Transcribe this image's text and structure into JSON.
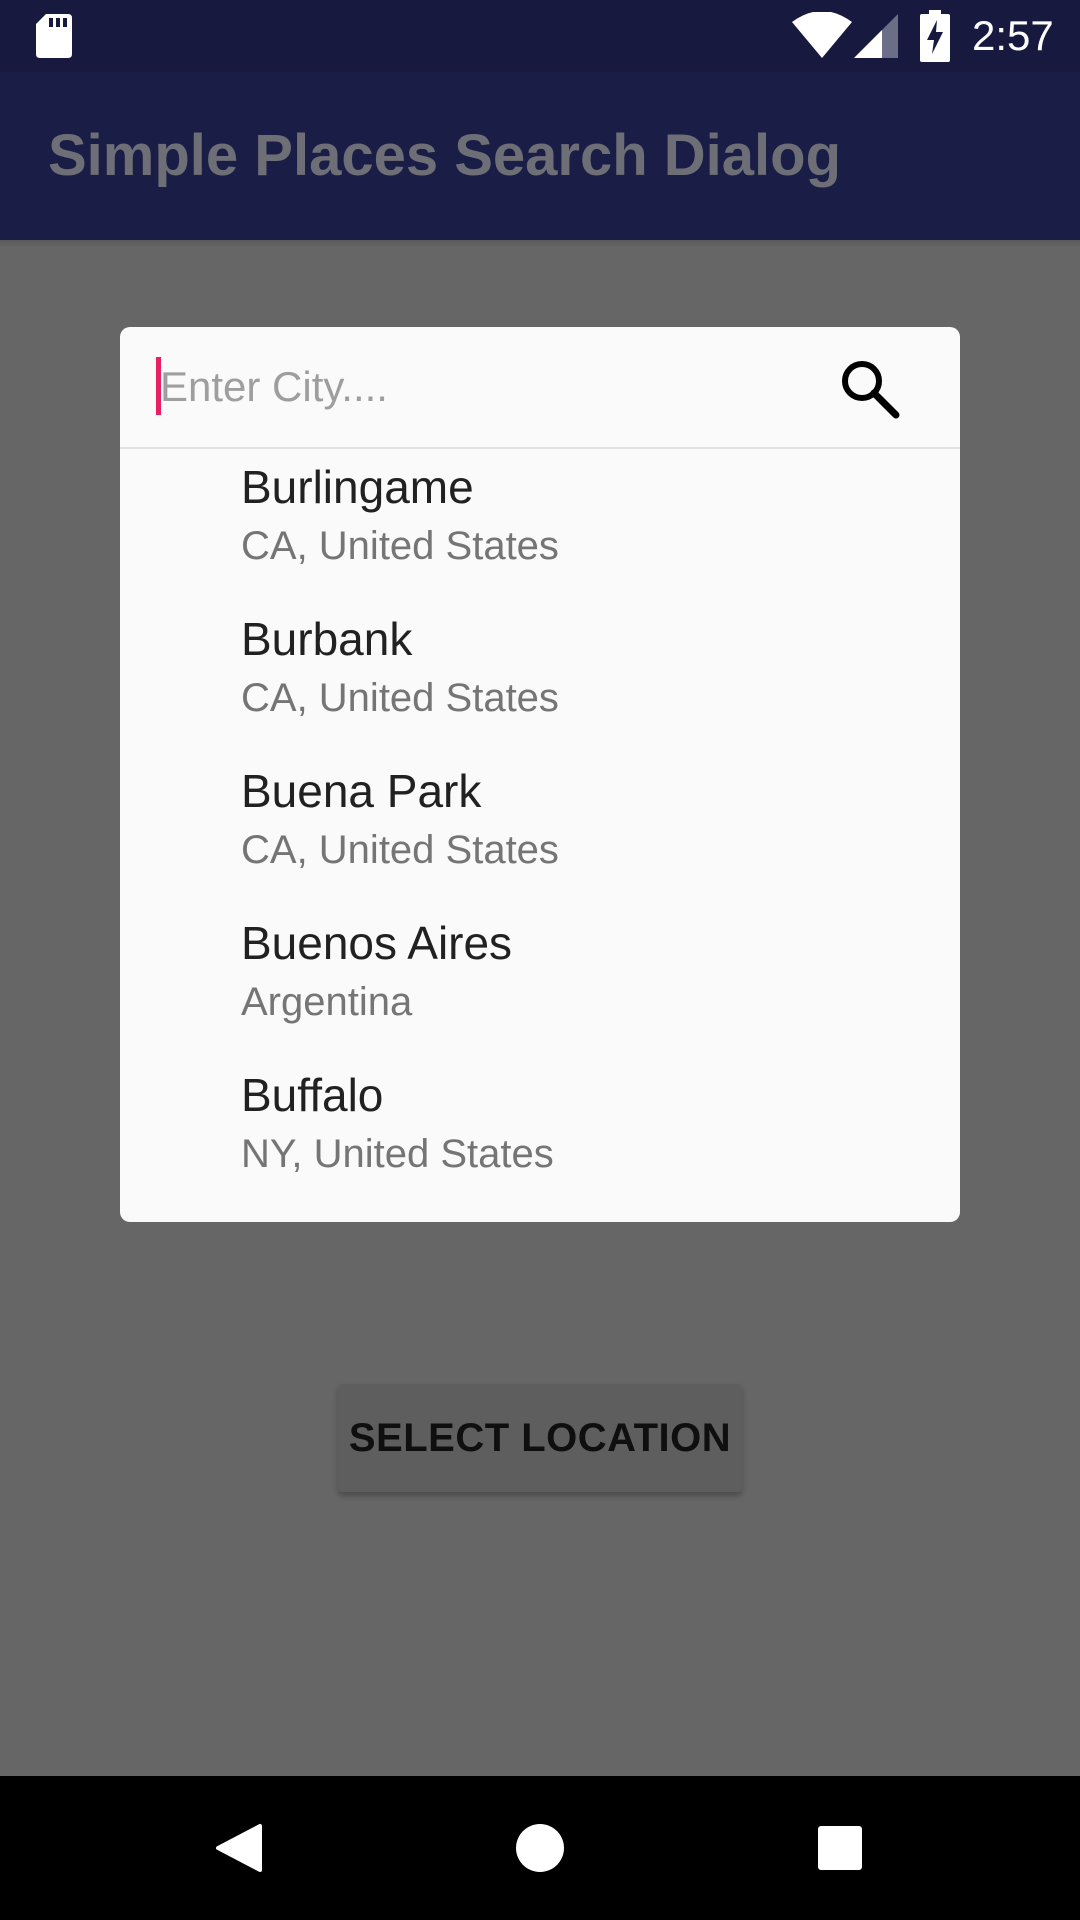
{
  "status_bar": {
    "time": "2:57",
    "icons": [
      "sd-card-icon",
      "wifi-icon",
      "cell-signal-icon",
      "battery-charging-icon"
    ]
  },
  "app_bar": {
    "title": "Simple Places Search Dialog"
  },
  "dialog": {
    "search": {
      "value": "",
      "placeholder": "Enter City....",
      "icon": "search-icon"
    },
    "results": [
      {
        "name": "Burlingame",
        "region": "CA, United States"
      },
      {
        "name": "Burbank",
        "region": "CA, United States"
      },
      {
        "name": "Buena Park",
        "region": "CA, United States"
      },
      {
        "name": "Buenos Aires",
        "region": "Argentina"
      },
      {
        "name": "Buffalo",
        "region": "NY, United States"
      }
    ]
  },
  "main": {
    "select_location_label": "SELECT LOCATION"
  },
  "nav_bar": {
    "icons": [
      "back-icon",
      "home-icon",
      "recents-icon"
    ]
  },
  "colors": {
    "status_bar": "#171a3e",
    "app_bar": "#1a1e46",
    "scrim_background": "#666666",
    "accent_cursor": "#e91e63",
    "dialog_background": "#fafafa"
  }
}
